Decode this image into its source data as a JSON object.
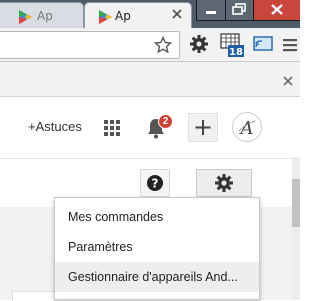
{
  "browser": {
    "tabs": [
      {
        "title": "Ap",
        "icon": "google-play-icon",
        "active": false
      },
      {
        "title": "Ap",
        "icon": "google-play-icon",
        "active": true
      }
    ],
    "extension_badge": "18"
  },
  "header": {
    "astuces_link": "+Astuces",
    "notification_count": "2",
    "avatar_letter": "A"
  },
  "settings_menu": {
    "items": [
      {
        "label": "Mes commandes"
      },
      {
        "label": "Paramètres"
      },
      {
        "label": "Gestionnaire d'appareils And..."
      }
    ]
  },
  "colors": {
    "tabstrip": "#4e5b68",
    "close_button": "#c9463d",
    "badge_red": "#d23f31",
    "play_green": "#34a853",
    "play_blue": "#4285f4",
    "play_yellow": "#fbbc05",
    "play_red": "#ea4335"
  }
}
